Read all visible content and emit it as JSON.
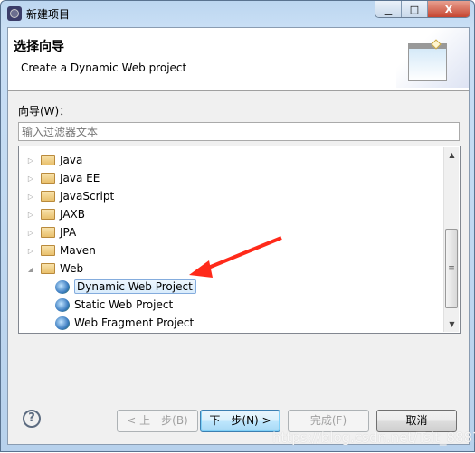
{
  "window": {
    "title": "新建项目",
    "controls": {
      "minimize": "▁",
      "maximize": "□",
      "close": "X"
    }
  },
  "header": {
    "title": "选择向导",
    "description": "Create a Dynamic Web project"
  },
  "filter": {
    "label": "向导(W)：",
    "placeholder": "输入过滤器文本",
    "value": ""
  },
  "tree": {
    "items": [
      {
        "label": "Java",
        "type": "folder",
        "expanded": false
      },
      {
        "label": "Java EE",
        "type": "folder",
        "expanded": false
      },
      {
        "label": "JavaScript",
        "type": "folder",
        "expanded": false
      },
      {
        "label": "JAXB",
        "type": "folder",
        "expanded": false
      },
      {
        "label": "JPA",
        "type": "folder",
        "expanded": false
      },
      {
        "label": "Maven",
        "type": "folder",
        "expanded": false
      },
      {
        "label": "Web",
        "type": "folder",
        "expanded": true
      },
      {
        "label": "Dynamic Web Project",
        "type": "project",
        "selected": true
      },
      {
        "label": "Static Web Project",
        "type": "project"
      },
      {
        "label": "Web Fragment Project",
        "type": "project"
      }
    ]
  },
  "buttons": {
    "help": "?",
    "back": "< 上一步(B)",
    "next": "下一步(N) >",
    "finish": "完成(F)",
    "cancel": "取消"
  },
  "annotation": {
    "color": "#ff2a1a"
  },
  "watermark": "https://blog.csdn.net/Tsit_8887"
}
